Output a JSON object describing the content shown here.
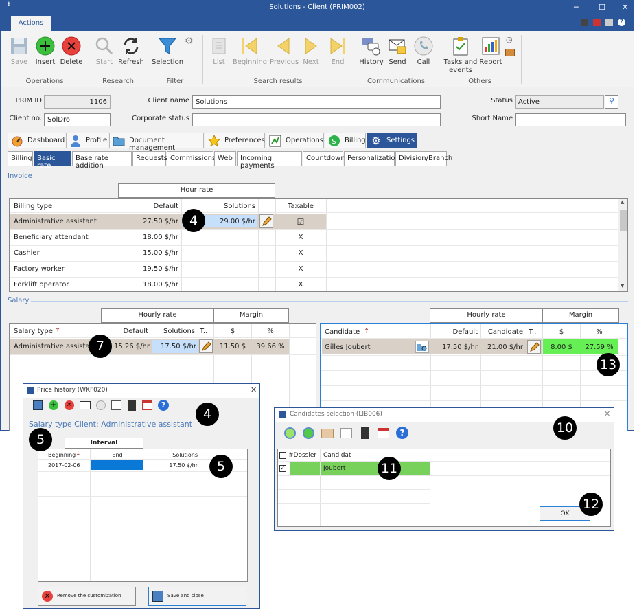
{
  "window": {
    "title": "Solutions - Client (PRIM002)"
  },
  "ribbon_tab": "Actions",
  "ribbon": {
    "buttons": {
      "save": "Save",
      "insert": "Insert",
      "delete": "Delete",
      "start": "Start",
      "refresh": "Refresh",
      "selection": "Selection",
      "list": "List",
      "beginning": "Beginning",
      "previous": "Previous",
      "next": "Next",
      "end": "End",
      "history": "History",
      "send": "Send",
      "call": "Call",
      "tasks1": "Tasks and",
      "tasks2": "events",
      "report": "Report"
    },
    "groups": {
      "operations": "Operations",
      "research": "Research",
      "filter": "Filter",
      "search_results": "Search results",
      "communications": "Communications",
      "others": "Others"
    }
  },
  "form": {
    "prim_id_label": "PRIM ID",
    "prim_id": "1106",
    "client_name_label": "Client name",
    "client_name": "Solutions",
    "status_label": "Status",
    "status": "Active",
    "client_no_label": "Client no.",
    "client_no": "SolDro",
    "corporate_status_label": "Corporate status",
    "corporate_status": "",
    "short_name_label": "Short Name",
    "short_name": ""
  },
  "tabs": [
    "Dashboard",
    "Profile",
    "Document management",
    "Preferences",
    "Operations",
    "Billing",
    "Settings"
  ],
  "subtabs": [
    "Billing",
    "Basic rate",
    "Base rate addition",
    "Requests",
    "Commissions",
    "Web",
    "Incoming payments",
    "Countdown",
    "Personalization",
    "Division/Branch"
  ],
  "invoice": {
    "section": "Invoice",
    "group_header": "Hour rate",
    "headers": {
      "billing_type": "Billing type",
      "default": "Default",
      "solutions": "Solutions",
      "taxable": "Taxable"
    },
    "rows": [
      {
        "type": "Administrative assistant",
        "default": "27.50 $/hr",
        "solutions": "29.00 $/hr",
        "taxable": "☑"
      },
      {
        "type": "Beneficiary attendant",
        "default": "18.00 $/hr",
        "solutions": "",
        "taxable": "X"
      },
      {
        "type": "Cashier",
        "default": "15.00 $/hr",
        "solutions": "",
        "taxable": "X"
      },
      {
        "type": "Factory worker",
        "default": "19.50 $/hr",
        "solutions": "",
        "taxable": "X"
      },
      {
        "type": "Forklift operator",
        "default": "18.00 $/hr",
        "solutions": "",
        "taxable": "X"
      }
    ]
  },
  "salary": {
    "section": "Salary",
    "hourly_header": "Hourly rate",
    "margin_header": "Margin",
    "headers": {
      "salary_type": "Salary type",
      "default": "Default",
      "solutions": "Solutions",
      "t": "T..",
      "dollar": "$",
      "pct": "%"
    },
    "row": {
      "type": "Administrative assistant",
      "default": "15.26 $/hr",
      "solutions": "17.50 $/hr",
      "margin_d": "11.50 $",
      "margin_p": "39.66 %"
    }
  },
  "candidate": {
    "hourly_header": "Hourly rate",
    "margin_header": "Margin",
    "headers": {
      "candidate": "Candidate",
      "default": "Default",
      "candidate_rate": "Candidate",
      "t": "T..",
      "dollar": "$",
      "pct": "%"
    },
    "row": {
      "name": "Gilles Joubert",
      "default": "17.50 $/hr",
      "candidate_rate": "21.00 $/hr",
      "margin_d": "8.00 $",
      "margin_p": "27.59 %"
    }
  },
  "price_history": {
    "title": "Price history (WKF020)",
    "subtitle": "Salary type Client: Administrative assistant",
    "interval": "Interval",
    "headers": {
      "beginning": "Beginning",
      "end": "End",
      "solutions": "Solutions"
    },
    "row": {
      "beginning": "2017-02-06",
      "end": "",
      "solutions": "17.50 $/hr"
    },
    "remove_button": "Remove the customization",
    "save_close_button": "Save and close"
  },
  "candidates_selection": {
    "title": "Candidates selection (LIB006)",
    "headers": {
      "dossier": "#Dossier",
      "candidat": "Candidat"
    },
    "row": {
      "candidat": "Joubert"
    },
    "ok": "OK"
  },
  "callouts": {
    "c4a": "4",
    "c7": "7",
    "c13": "13",
    "c4b": "4",
    "c5a": "5",
    "c5b": "5",
    "c10": "10",
    "c11": "11",
    "c12": "12"
  },
  "colors": {
    "brand": "#2b579a",
    "selected_row": "#d9d1c7",
    "edited_cell": "#c6e0fb",
    "margin_green": "#66ee55",
    "candidate_green": "#77d15a"
  }
}
